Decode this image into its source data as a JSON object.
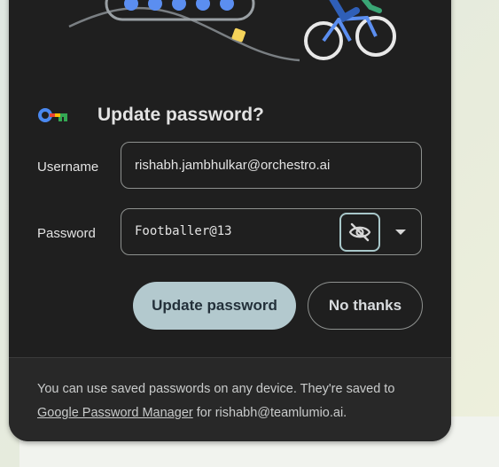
{
  "dialog": {
    "title": "Update password?",
    "username_label": "Username",
    "username_value": "rishabh.jambhulkar@orchestro.ai",
    "password_label": "Password",
    "password_value": "Footballer@13",
    "update_button": "Update password",
    "no_thanks_button": "No thanks",
    "footer_text_1": "You can use saved passwords on any device. They're saved to",
    "footer_link": "Google Password Manager",
    "footer_text_2": "for rishabh@teamlumio.ai."
  },
  "icons": {
    "key": "google-key-icon",
    "eye": "eye-off-icon",
    "dropdown": "chevron-down-icon"
  },
  "colors": {
    "dialog_bg": "#1f1f1f",
    "footer_bg": "#282828",
    "primary_button": "#b3c9ce",
    "focus_ring": "#a8c7c9"
  }
}
